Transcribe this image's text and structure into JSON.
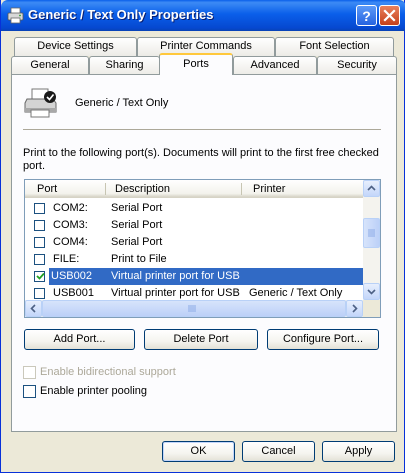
{
  "window": {
    "title": "Generic / Text Only Properties",
    "icon": "printer-icon"
  },
  "tabs": {
    "row1": [
      {
        "label": "Device Settings"
      },
      {
        "label": "Printer Commands"
      },
      {
        "label": "Font Selection"
      }
    ],
    "row2": [
      {
        "label": "General"
      },
      {
        "label": "Sharing"
      },
      {
        "label": "Ports"
      },
      {
        "label": "Advanced"
      },
      {
        "label": "Security"
      }
    ],
    "active": "Ports"
  },
  "printer": {
    "name": "Generic / Text Only"
  },
  "instructions": "Print to the following port(s). Documents will print to the first free checked port.",
  "ports_list": {
    "columns": [
      "Port",
      "Description",
      "Printer"
    ],
    "rows": [
      {
        "port": "COM2:",
        "description": "Serial Port",
        "printer": "",
        "checked": false,
        "selected": false
      },
      {
        "port": "COM3:",
        "description": "Serial Port",
        "printer": "",
        "checked": false,
        "selected": false
      },
      {
        "port": "COM4:",
        "description": "Serial Port",
        "printer": "",
        "checked": false,
        "selected": false
      },
      {
        "port": "FILE:",
        "description": "Print to File",
        "printer": "",
        "checked": false,
        "selected": false
      },
      {
        "port": "USB002",
        "description": "Virtual printer port for USB",
        "printer": "",
        "checked": true,
        "selected": true
      },
      {
        "port": "USB001",
        "description": "Virtual printer port for USB",
        "printer": "Generic / Text Only",
        "checked": false,
        "selected": false
      }
    ]
  },
  "port_buttons": {
    "add": "Add Port...",
    "delete": "Delete Port",
    "configure": "Configure Port..."
  },
  "options": {
    "bidirectional": {
      "label": "Enable bidirectional support",
      "checked": false,
      "enabled": false
    },
    "pooling": {
      "label": "Enable printer pooling",
      "checked": false,
      "enabled": true
    }
  },
  "dialog_buttons": {
    "ok": "OK",
    "cancel": "Cancel",
    "apply": "Apply"
  },
  "colors": {
    "titlebar": "#0A5FEA",
    "selection": "#316AC5",
    "active_tab_accent": "#FFC83C",
    "dialog_bg": "#ECE9D8"
  }
}
